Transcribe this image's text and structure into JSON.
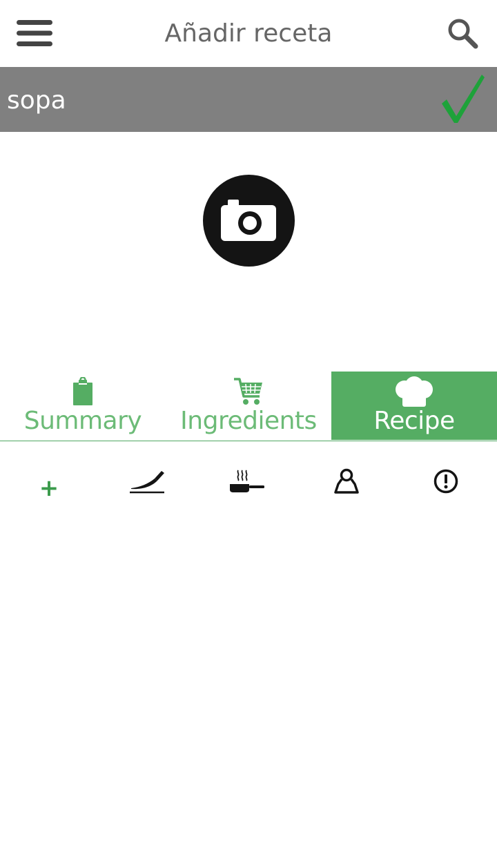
{
  "header": {
    "title": "Añadir receta",
    "menu_icon": "hamburger-menu-icon",
    "search_icon": "search-icon"
  },
  "recipe_name": {
    "value": "sopa",
    "confirm_icon": "checkmark-icon"
  },
  "photo": {
    "icon": "camera-icon"
  },
  "tabs": [
    {
      "label": "Summary",
      "icon": "clipboard-icon",
      "selected": false
    },
    {
      "label": "Ingredients",
      "icon": "shopping-cart-icon",
      "selected": false
    },
    {
      "label": "Recipe",
      "icon": "chef-hat-icon",
      "selected": true
    }
  ],
  "toolbar": {
    "add_label": "+",
    "icons": [
      "add-icon",
      "knife-icon",
      "pan-icon",
      "weight-icon",
      "alert-icon"
    ]
  },
  "colors": {
    "accent_green": "#55ad63",
    "tab_text_green": "#6cbb77",
    "name_bar_gray": "#808080",
    "check_green": "#1ea23a",
    "title_gray": "#666666"
  }
}
